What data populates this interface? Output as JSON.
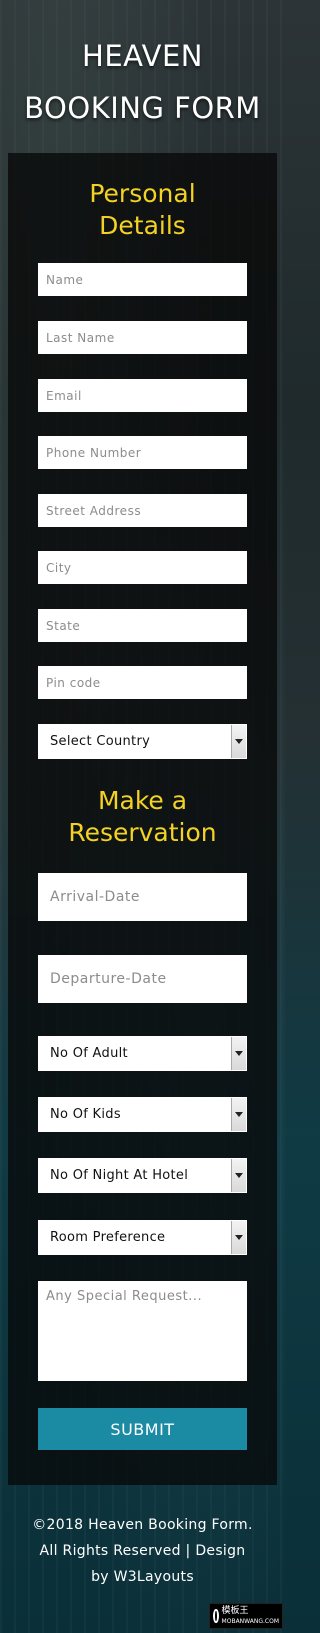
{
  "page": {
    "title_line1": "HEAVEN",
    "title_line2": "BOOKING FORM"
  },
  "personal": {
    "heading_line1": "Personal",
    "heading_line2": "Details",
    "fields": {
      "name": "Name",
      "last_name": "Last Name",
      "email": "Email",
      "phone": "Phone Number",
      "street": "Street Address",
      "city": "City",
      "state": "State",
      "pin": "Pin code"
    },
    "country_select": "Select Country"
  },
  "reservation": {
    "heading_line1": "Make a",
    "heading_line2": "Reservation",
    "arrival": "Arrival-Date",
    "departure": "Departure-Date",
    "adults": "No Of Adult",
    "kids": "No Of Kids",
    "nights": "No Of Night At Hotel",
    "room": "Room Preference",
    "special": "Any Special Request...",
    "submit": "SUBMIT"
  },
  "footer": {
    "line1": "©2018 Heaven Booking Form.",
    "line2": "All Rights Reserved | Design",
    "line3": "by W3Layouts"
  },
  "watermark": {
    "text": "模板王",
    "site": "MOBANWANG.COM"
  },
  "colors": {
    "accent": "#f4d224",
    "button": "#1b8aa3"
  }
}
